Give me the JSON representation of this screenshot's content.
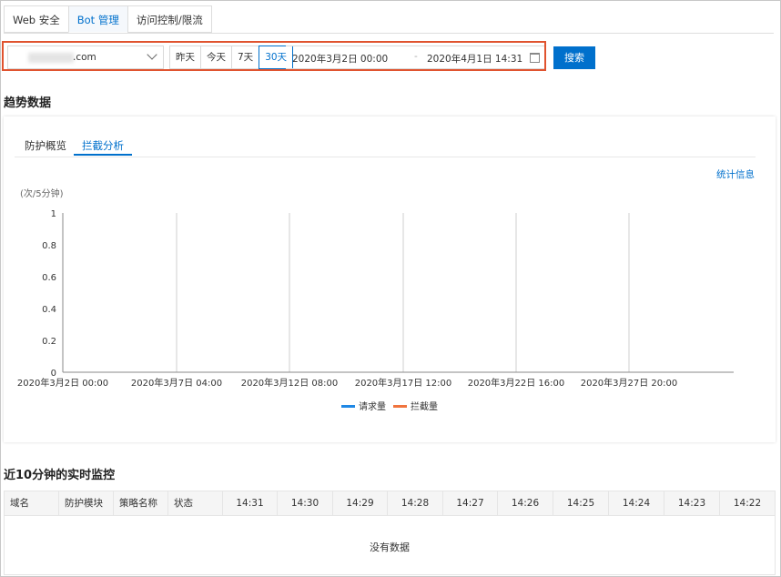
{
  "tabs": [
    {
      "label": "Web 安全",
      "active": false
    },
    {
      "label": "Bot 管理",
      "active": true
    },
    {
      "label": "访问控制/限流",
      "active": false
    }
  ],
  "filter": {
    "domain_suffix": ".com",
    "quick_ranges": [
      {
        "label": "昨天",
        "active": false
      },
      {
        "label": "今天",
        "active": false
      },
      {
        "label": "7天",
        "active": false
      },
      {
        "label": "30天",
        "active": true
      }
    ],
    "start": "2020年3月2日 00:00",
    "separator": "-",
    "end": "2020年4月1日 14:31",
    "search_label": "搜索"
  },
  "trend": {
    "title": "趋势数据",
    "tabs": [
      {
        "label": "防护概览",
        "active": false
      },
      {
        "label": "拦截分析",
        "active": true
      }
    ],
    "stats_link": "统计信息",
    "unit": "(次/5分钟)"
  },
  "chart_data": {
    "type": "line",
    "ylabel": "(次/5分钟)",
    "ylim": [
      0,
      1
    ],
    "yticks": [
      "0",
      "0.2",
      "0.4",
      "0.6",
      "0.8",
      "1"
    ],
    "x_ticks": [
      "2020年3月2日 00:00",
      "2020年3月7日 04:00",
      "2020年3月12日 08:00",
      "2020年3月17日 12:00",
      "2020年3月22日 16:00",
      "2020年3月27日 20:00"
    ],
    "series": [
      {
        "name": "请求量",
        "color": "#1f88e5",
        "values": []
      },
      {
        "name": "拦截量",
        "color": "#f0743e",
        "values": []
      }
    ],
    "grid": "vertical"
  },
  "realtime": {
    "title": "近10分钟的实时监控",
    "columns": [
      "域名",
      "防护模块",
      "策略名称",
      "状态",
      "14:31",
      "14:30",
      "14:29",
      "14:28",
      "14:27",
      "14:26",
      "14:25",
      "14:24",
      "14:23",
      "14:22"
    ],
    "empty_text": "没有数据"
  }
}
